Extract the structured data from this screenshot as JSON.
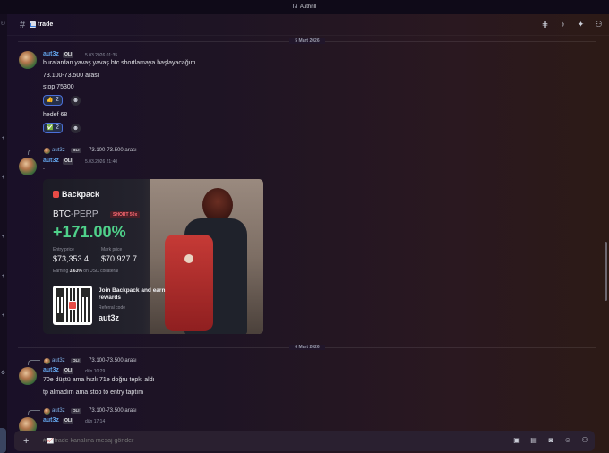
{
  "window": {
    "title": "Authrill"
  },
  "channel": {
    "name": "trade",
    "emoji": "chart-icon"
  },
  "header_icons": [
    "threads-icon",
    "bell-icon",
    "pin-icon",
    "members-icon"
  ],
  "dividers": [
    "5 Mart 2026",
    "6 Mart 2026"
  ],
  "messages": [
    {
      "author": "aut3z",
      "tag": "OLI",
      "time": "5.03.2026 01:35",
      "lines": [
        "buralardan yavaş yavaş btc shortlamaya başlayacağım",
        "73.100-73.500 arası",
        "stop 75300"
      ],
      "reaction1": {
        "emoji": "👍",
        "count": "2"
      },
      "line_after": "hedef 68",
      "reaction2": {
        "emoji": "✅",
        "count": "2"
      }
    },
    {
      "reply": {
        "author": "aut3z",
        "tag": "OLI",
        "text": "73.100-73.500 arası"
      },
      "author": "aut3z",
      "tag": "OLI",
      "time": "5.03.2026 21:40",
      "line": ".",
      "card": {
        "brand": "Backpack",
        "pair": "BTC",
        "pair_suffix": "-PERP",
        "side": "SHORT 50x",
        "pnl": "+171.00%",
        "entry_label": "Entry price",
        "entry_value": "$73,353.4",
        "mark_label": "Mark price",
        "mark_value": "$70,927.7",
        "earning_prefix": "Earning",
        "earning_value": "3.63%",
        "earning_suffix": "on USD collateral",
        "join": "Join Backpack and earn rewards",
        "ref_label": "Referral code",
        "ref_code": "aut3z"
      }
    },
    {
      "reply": {
        "author": "aut3z",
        "tag": "OLI",
        "text": "73.100-73.500 arası"
      },
      "author": "aut3z",
      "tag": "OLI",
      "time": "dün 10:29",
      "lines": [
        "70e düştü ama hızlı 71e doğru tepki aldı",
        "tp almadım ama stop to entry taptım"
      ]
    },
    {
      "reply": {
        "author": "aut3z",
        "tag": "OLI",
        "text": "73.100-73.500 arası"
      },
      "author": "aut3z",
      "tag": "OLI",
      "time": "dün 17:14"
    }
  ],
  "composer": {
    "placeholder": "#📈trade kanalına mesaj gönder",
    "icons": [
      "gift-icon",
      "gif-icon",
      "sticker-icon",
      "emoji-icon",
      "apps-icon"
    ]
  },
  "colors": {
    "accent": "#62a2e8",
    "pnl_green": "#4fd18a",
    "brand_red": "#e84b46"
  }
}
